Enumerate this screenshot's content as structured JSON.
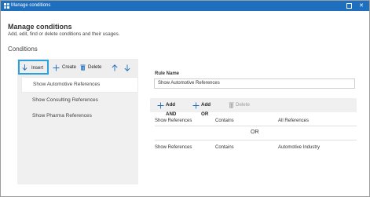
{
  "window": {
    "title": "Manage conditions",
    "accent_color": "#1f6fbf",
    "maximize_icon": "maximize-icon",
    "close_icon": "close-icon",
    "close_glyph": "✕"
  },
  "header": {
    "title": "Manage conditions",
    "subtitle": "Add, edit, find or delete conditions and their usages."
  },
  "conditions": {
    "section_label": "Conditions",
    "toolbar": {
      "insert_label": "Insert",
      "create_label": "Create",
      "delete_label": "Delete"
    },
    "items": [
      {
        "label": "Show Automotive References",
        "selected": true
      },
      {
        "label": "Show Consulting References",
        "selected": false
      },
      {
        "label": "Show Pharma References",
        "selected": false
      }
    ]
  },
  "rule": {
    "name_label": "Rule Name",
    "name_value": "Show Automotive References",
    "add_and_label": "Add AND",
    "add_or_label": "Add OR",
    "delete_label": "Delete",
    "operator_label": "OR",
    "rows": [
      {
        "field": "Show References",
        "operator": "Contains",
        "value": "All References"
      },
      {
        "field": "Show References",
        "operator": "Contains",
        "value": "Automotive Industry"
      }
    ]
  }
}
